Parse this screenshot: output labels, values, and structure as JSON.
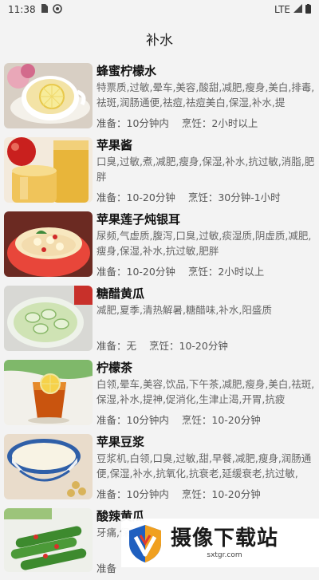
{
  "status_bar": {
    "time": "11:38",
    "network": "LTE"
  },
  "header": {
    "title": "补水"
  },
  "items": [
    {
      "title": "蜂蜜柠檬水",
      "tags": "特票质,过敏,晕车,美容,酸甜,减肥,瘦身,美白,排毒,祛斑,润肠通便,祛痘,祛痘美白,保湿,补水,提",
      "prep": "准备：10分钟内",
      "cook": "烹饪：2小时以上"
    },
    {
      "title": "苹果酱",
      "tags": "口臭,过敏,煮,减肥,瘦身,保湿,补水,抗过敏,消脂,肥胖",
      "prep": "准备：10-20分钟",
      "cook": "烹饪：30分钟-1小时"
    },
    {
      "title": "苹果莲子炖银耳",
      "tags": "尿频,气虚质,腹泻,口臭,过敏,痰湿质,阴虚质,减肥,瘦身,保湿,补水,抗过敏,肥胖",
      "prep": "准备：10-20分钟",
      "cook": "烹饪：2小时以上"
    },
    {
      "title": "糖醋黄瓜",
      "tags": "减肥,夏季,清热解暑,糖醋味,补水,阳盛质",
      "prep": "准备：无",
      "cook": "烹饪：10-20分钟"
    },
    {
      "title": "柠檬茶",
      "tags": "白领,晕车,美容,饮品,下午茶,减肥,瘦身,美白,祛斑,保湿,补水,提神,促消化,生津止渴,开胃,抗疲",
      "prep": "准备：10分钟内",
      "cook": "烹饪：10-20分钟"
    },
    {
      "title": "苹果豆浆",
      "tags": "豆浆机,白领,口臭,过敏,甜,早餐,减肥,瘦身,润肠通便,保湿,补水,抗氧化,抗衰老,延缓衰老,抗过敏,",
      "prep": "准备：10分钟内",
      "cook": "烹饪：10-20分钟"
    },
    {
      "title": "酸辣黄瓜",
      "tags": "牙痛,保湿,",
      "prep": "准备",
      "cook": ""
    }
  ],
  "watermark": {
    "title": "摄像下载站",
    "url": "sxtgr.com"
  }
}
